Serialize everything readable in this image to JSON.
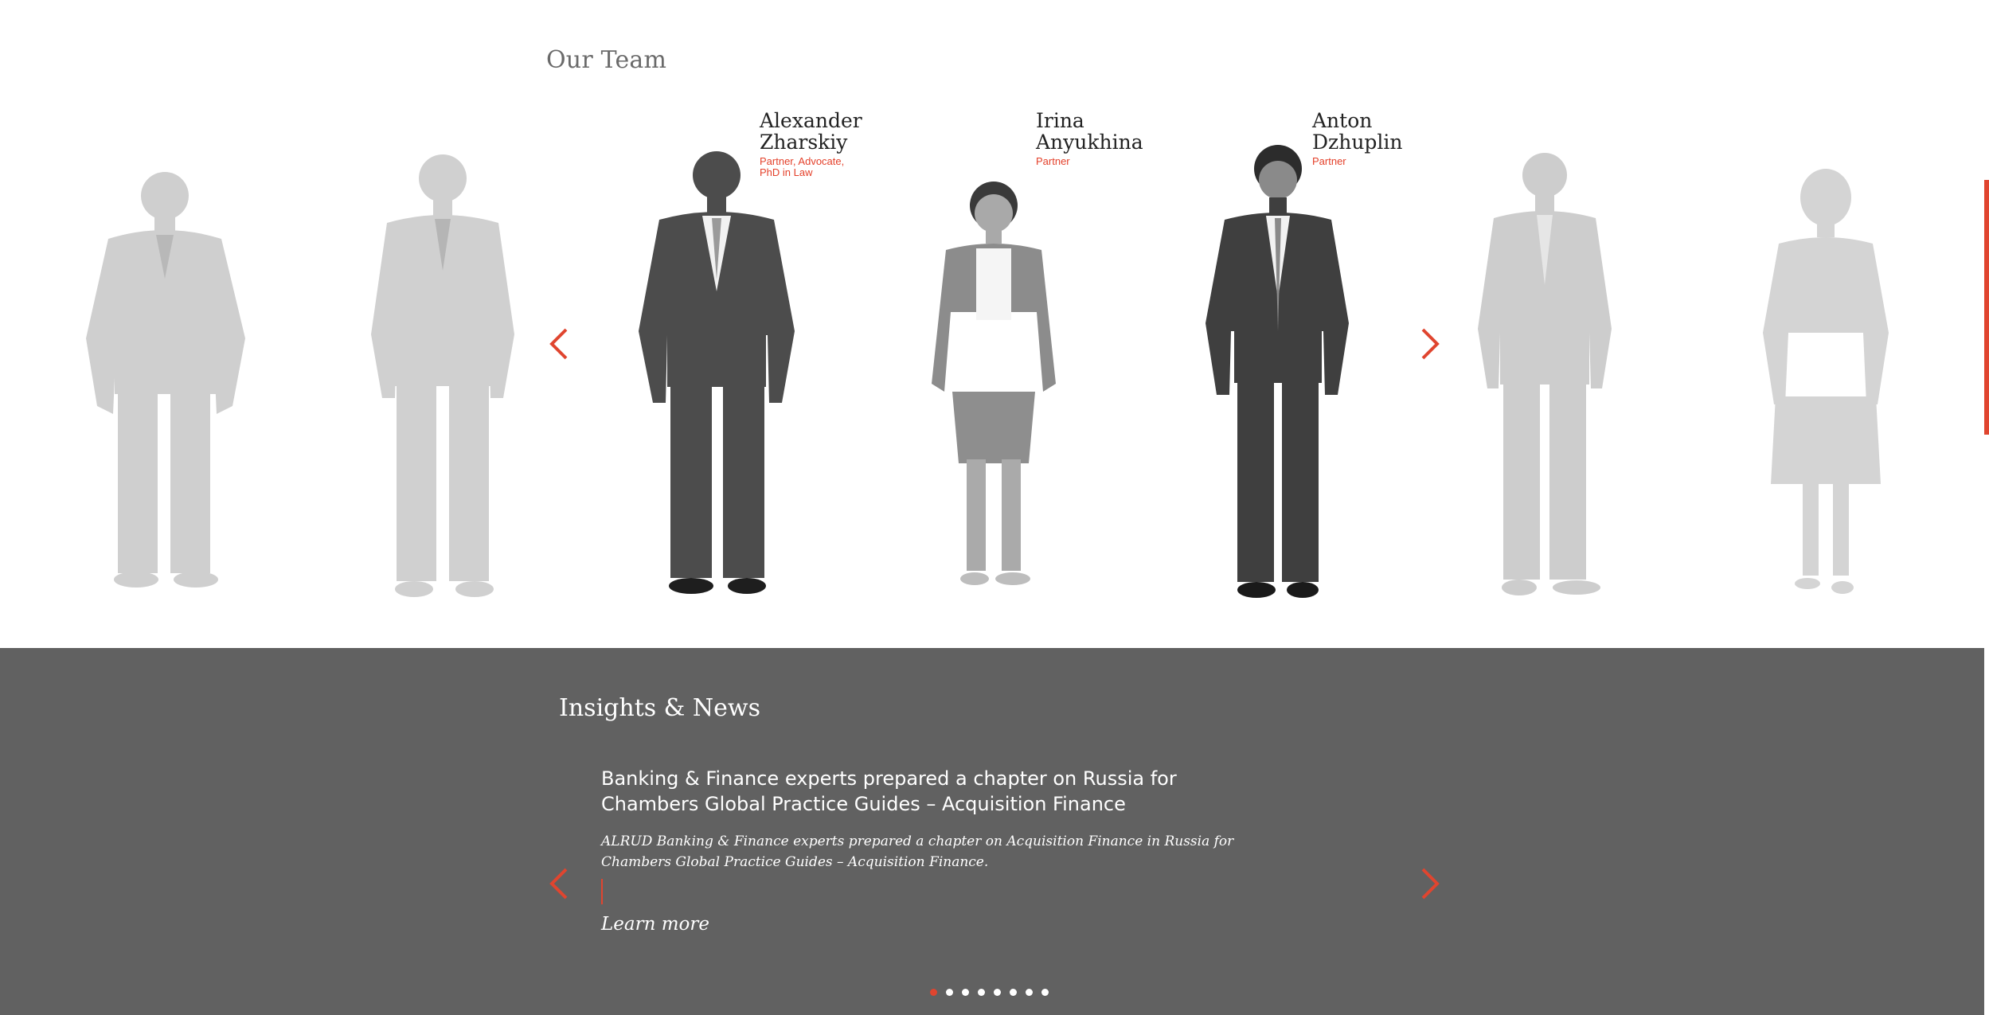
{
  "team": {
    "title": "Our Team",
    "members": [
      {
        "name": "Alexander\nZharskiy",
        "role": "Partner, Advocate,\nPhD in Law"
      },
      {
        "name": "Irina\nAnyukhina",
        "role": "Partner"
      },
      {
        "name": "Anton\nDzhuplin",
        "role": "Partner"
      }
    ]
  },
  "news": {
    "title": "Insights & News",
    "headline": "Banking & Finance experts prepared a chapter on Russia for Chambers Global Practice Guides – Acquisition Finance",
    "summary": "ALRUD Banking & Finance experts prepared a chapter on Acquisition Finance in Russia for Chambers Global Practice Guides – Acquisition Finance.",
    "learn_more": "Learn more",
    "dot_count": 8,
    "active_dot": 1
  },
  "colors": {
    "accent": "#e0452f",
    "news_bg": "#616161",
    "faded_person": "#c8c8c8",
    "active_person": "#5a5a5a"
  },
  "icons": [
    "chevron-left-icon",
    "chevron-right-icon"
  ]
}
